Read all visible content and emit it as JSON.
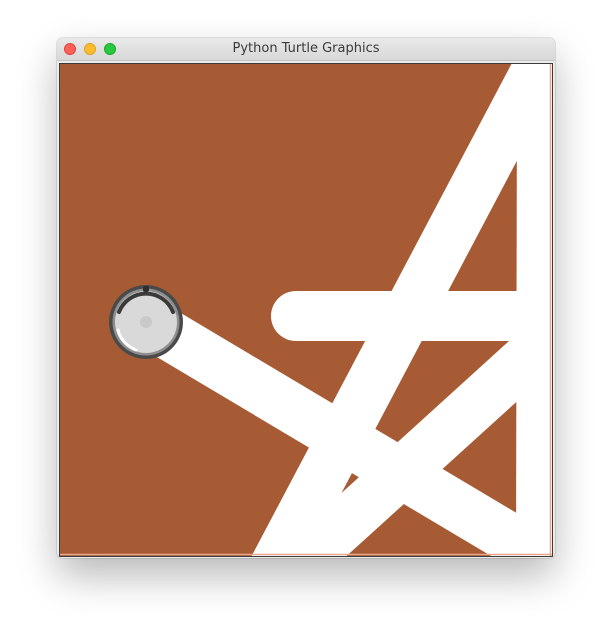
{
  "window": {
    "title": "Python Turtle Graphics"
  },
  "canvas": {
    "background_color": "#A65B35",
    "pen_color": "#FFFFFF",
    "border_color": "#E8A78B"
  },
  "turtle": {
    "shape": "roomba-robot-icon"
  }
}
